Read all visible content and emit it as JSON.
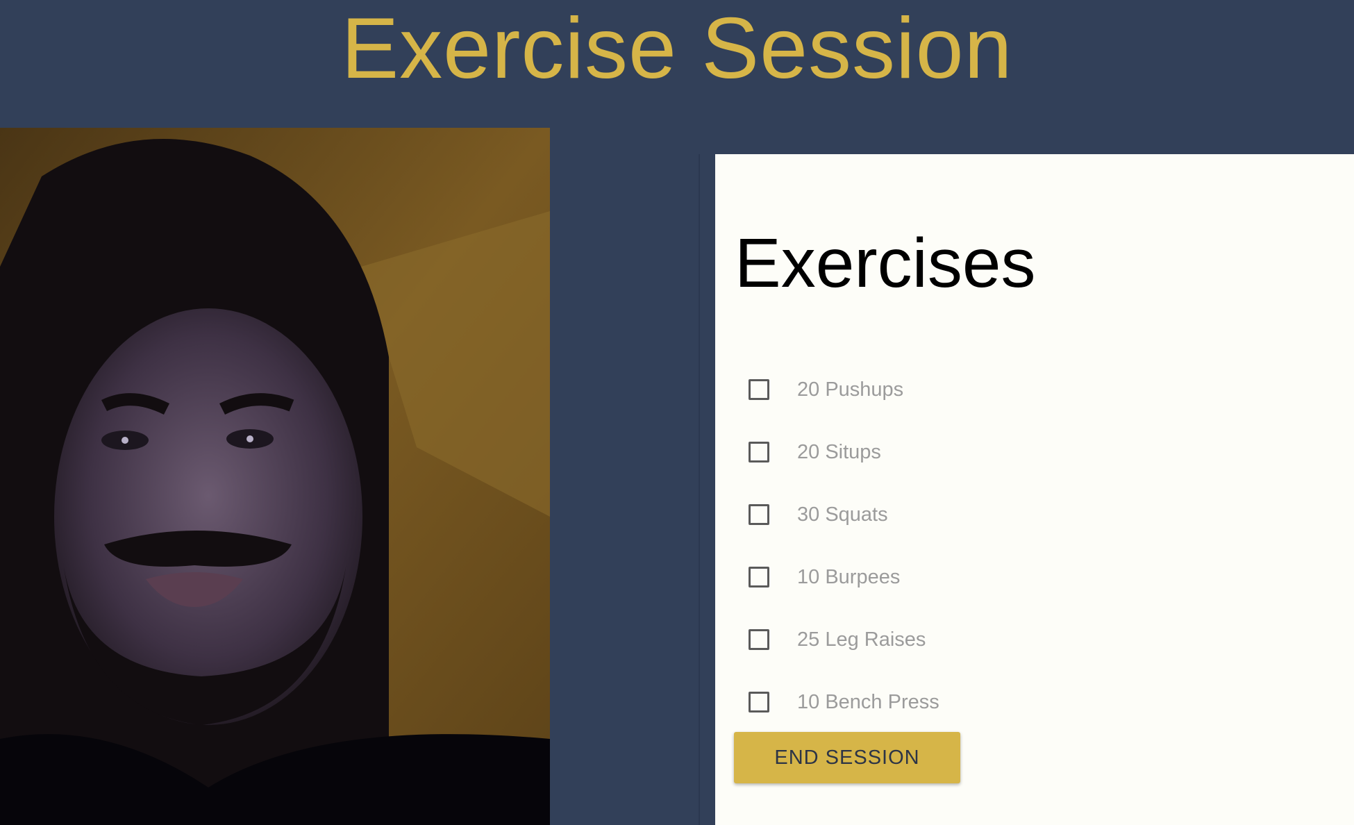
{
  "header": {
    "title": "Exercise Session"
  },
  "webcam": {
    "icon": "person-webcam-feed"
  },
  "exercises_panel": {
    "title": "Exercises",
    "items": [
      {
        "label": "20 Pushups",
        "checked": false
      },
      {
        "label": "20 Situps",
        "checked": false
      },
      {
        "label": "30 Squats",
        "checked": false
      },
      {
        "label": "10 Burpees",
        "checked": false
      },
      {
        "label": "25 Leg Raises",
        "checked": false
      },
      {
        "label": "10 Bench Press",
        "checked": false
      }
    ],
    "end_button_label": "END SESSION"
  },
  "colors": {
    "background": "#324059",
    "accent": "#d6b548",
    "panel": "#fdfdf8"
  }
}
